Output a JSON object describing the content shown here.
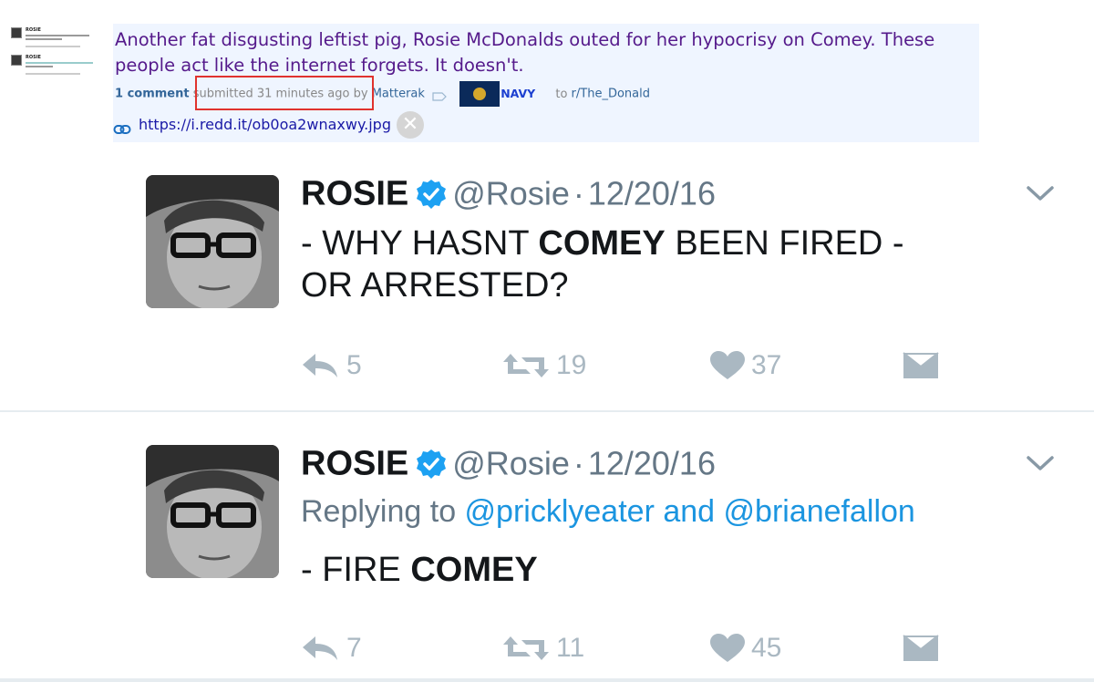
{
  "post": {
    "title": "Another fat disgusting leftist pig, Rosie McDonalds outed for her hypocrisy on Comey. These people act like the internet forgets. It doesn't.",
    "comments": "1 comment",
    "submitted": "submitted 31 minutes ago",
    "by_prefix": "by",
    "author": "Matterak",
    "flair_text": "NAVY",
    "to_prefix": "to",
    "subreddit": "r/The_Donald",
    "link_url": "https://i.redd.it/ob0oa2wnaxwy.jpg",
    "close_glyph": "✕"
  },
  "thumbnail": {
    "name1": "ROSIE",
    "name2": "ROSIE",
    "line1": "- WHY HASNT COMEY BEEN FIRED -",
    "line2": "OR ARRESTED?",
    "line3": "- FIRE COMEY"
  },
  "tweets": [
    {
      "name": "ROSIE",
      "handle": "@Rosie",
      "dot": "·",
      "date": "12/20/16",
      "text_a": "- WHY HASNT ",
      "text_bold": "COMEY",
      "text_b": " BEEN FIRED -",
      "text_line2": "OR ARRESTED?",
      "reply_count": "5",
      "retweet_count": "19",
      "like_count": "37"
    },
    {
      "name": "ROSIE",
      "handle": "@Rosie",
      "dot": "·",
      "date": "12/20/16",
      "replying_prefix": "Replying to ",
      "mention1": "@pricklyeater",
      "replying_and": " and ",
      "mention2": "@brianefallon",
      "text_a": "- FIRE ",
      "text_bold": "COMEY",
      "reply_count": "7",
      "retweet_count": "11",
      "like_count": "45"
    }
  ],
  "icons": {
    "verified": "verified-badge-icon",
    "chevron": "chevron-down-icon",
    "reply": "reply-icon",
    "retweet": "retweet-icon",
    "like": "heart-icon",
    "dm": "envelope-icon",
    "link": "link-icon",
    "tag": "tag-icon"
  },
  "colors": {
    "post_bg": "#eff5ff",
    "title": "#551a8b",
    "highlight": "#e0332e",
    "twitter_blue": "#1da1f2",
    "mention": "#1b95e0",
    "action_gray": "#aab8c2"
  }
}
